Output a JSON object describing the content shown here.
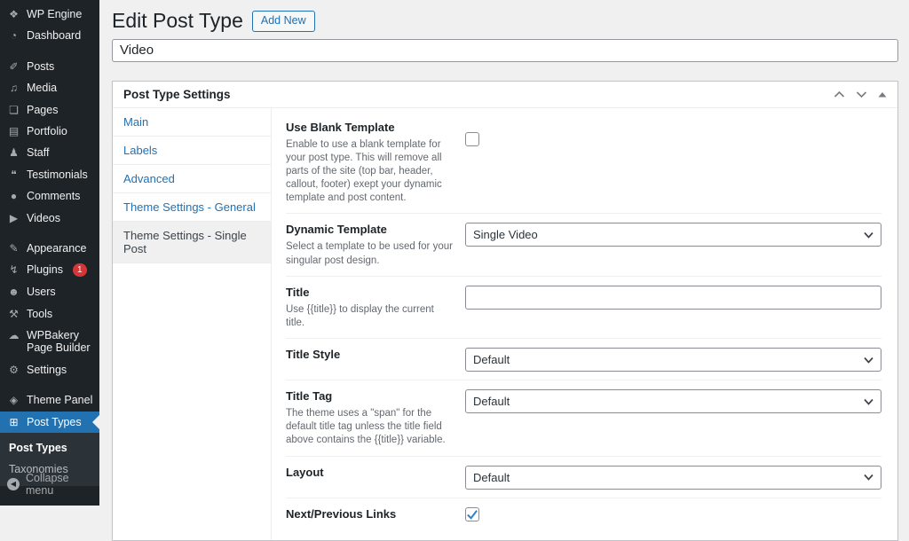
{
  "colors": {
    "sidebar_bg": "#1d2327",
    "submenu_bg": "#2c3338",
    "accent_blue": "#2271b1",
    "badge_red": "#d63638",
    "content_bg": "#f0f0f1",
    "box_border": "#c3c4c7",
    "muted_text": "#646970",
    "check_blue": "#3582c4"
  },
  "sidebar": {
    "groups": [
      {
        "items": [
          {
            "icon": "wp-engine-icon",
            "glyph": "❖",
            "label": "WP Engine"
          },
          {
            "icon": "dashboard-icon",
            "glyph": "◔",
            "label": "Dashboard"
          }
        ]
      },
      {
        "items": [
          {
            "icon": "posts-icon",
            "glyph": "✐",
            "label": "Posts"
          },
          {
            "icon": "media-icon",
            "glyph": "♫",
            "label": "Media"
          },
          {
            "icon": "pages-icon",
            "glyph": "❏",
            "label": "Pages"
          },
          {
            "icon": "portfolio-icon",
            "glyph": "▤",
            "label": "Portfolio"
          },
          {
            "icon": "staff-icon",
            "glyph": "♟",
            "label": "Staff"
          },
          {
            "icon": "testimonials-icon",
            "glyph": "❝",
            "label": "Testimonials"
          },
          {
            "icon": "comments-icon",
            "glyph": "●",
            "label": "Comments"
          },
          {
            "icon": "videos-icon",
            "glyph": "▶",
            "label": "Videos"
          }
        ]
      },
      {
        "items": [
          {
            "icon": "appearance-icon",
            "glyph": "✎",
            "label": "Appearance"
          },
          {
            "icon": "plugins-icon",
            "glyph": "↯",
            "label": "Plugins",
            "badge": "1"
          },
          {
            "icon": "users-icon",
            "glyph": "☻",
            "label": "Users"
          },
          {
            "icon": "tools-icon",
            "glyph": "⚒",
            "label": "Tools"
          },
          {
            "icon": "wpbakery-icon",
            "glyph": "☁",
            "label": "WPBakery Page Builder"
          },
          {
            "icon": "settings-icon",
            "glyph": "⚙",
            "label": "Settings"
          }
        ]
      },
      {
        "items": [
          {
            "icon": "theme-panel-icon",
            "glyph": "◈",
            "label": "Theme Panel"
          },
          {
            "icon": "post-types-icon",
            "glyph": "⊞",
            "label": "Post Types",
            "active": true
          }
        ]
      }
    ],
    "submenu": {
      "items": [
        {
          "label": "Post Types",
          "active": true
        },
        {
          "label": "Taxonomies"
        }
      ]
    },
    "collapse": {
      "icon": "collapse-icon",
      "glyph": "◀",
      "label": "Collapse menu"
    }
  },
  "header": {
    "title": "Edit Post Type",
    "add_new_label": "Add New"
  },
  "post_type_name": {
    "value": "Video"
  },
  "metabox": {
    "title": "Post Type Settings",
    "actions": {
      "move_up_icon": "chevron-up-icon",
      "move_down_icon": "chevron-down-icon",
      "toggle_icon": "triangle-up-icon"
    },
    "tabs": [
      {
        "label": "Main"
      },
      {
        "label": "Labels"
      },
      {
        "label": "Advanced"
      },
      {
        "label": "Theme Settings - General"
      },
      {
        "label": "Theme Settings - Single Post",
        "active": true
      }
    ],
    "fields": [
      {
        "label": "Use Blank Template",
        "description": "Enable to use a blank template for your post type. This will remove all parts of the site (top bar, header, callout, footer) exept your dynamic template and post content.",
        "control": "checkbox",
        "checked": false
      },
      {
        "label": "Dynamic Template",
        "description": "Select a template to be used for your singular post design.",
        "control": "select",
        "value": "Single Video"
      },
      {
        "label": "Title",
        "description": "Use {{title}} to display the current title.",
        "control": "text",
        "value": ""
      },
      {
        "label": "Title Style",
        "description": "",
        "control": "select",
        "value": "Default"
      },
      {
        "label": "Title Tag",
        "description": "The theme uses a \"span\" for the default title tag unless the title field above contains the {{title}} variable.",
        "control": "select",
        "value": "Default"
      },
      {
        "label": "Layout",
        "description": "",
        "control": "select",
        "value": "Default"
      },
      {
        "label": "Next/Previous Links",
        "description": "",
        "control": "checkbox",
        "checked": true
      }
    ]
  }
}
